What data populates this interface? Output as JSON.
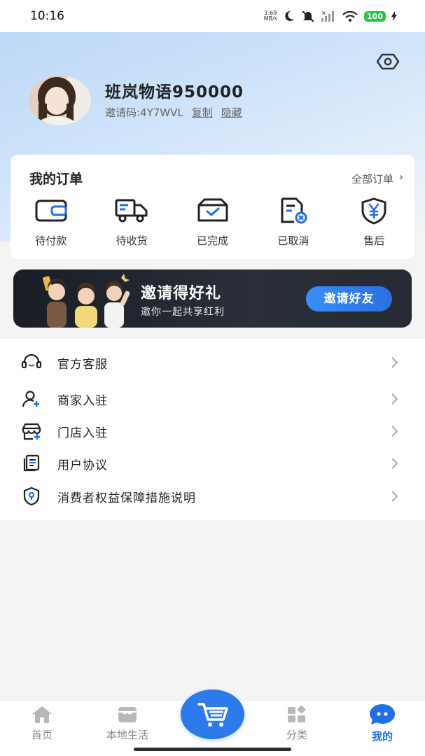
{
  "status_bar": {
    "time": "10:16",
    "net_speed_value": "1.69",
    "net_speed_unit": "MB/s",
    "battery": "100"
  },
  "profile": {
    "username": "班岚物语950000",
    "invite_code": "邀请码:4Y7WVL",
    "copy_label": "复制",
    "hide_label": "隐藏"
  },
  "orders": {
    "title": "我的订单",
    "all_label": "全部订单",
    "items": [
      {
        "label": "待付款",
        "icon": "wallet-icon"
      },
      {
        "label": "待收货",
        "icon": "truck-icon"
      },
      {
        "label": "已完成",
        "icon": "box-check-icon"
      },
      {
        "label": "已取消",
        "icon": "doc-cancel-icon"
      },
      {
        "label": "售后",
        "icon": "yen-shield-icon"
      }
    ]
  },
  "banner": {
    "title": "邀请得好礼",
    "subtitle": "邀你一起共享红利",
    "button": "邀请好友"
  },
  "menu": {
    "items": [
      {
        "label": "官方客服",
        "icon": "headset-icon"
      },
      {
        "label": "商家入驻",
        "icon": "user-plus-icon"
      },
      {
        "label": "门店入驻",
        "icon": "store-plus-icon"
      },
      {
        "label": "用户协议",
        "icon": "document-icon"
      },
      {
        "label": "消费者权益保障措施说明",
        "icon": "shield-icon"
      }
    ]
  },
  "tabbar": {
    "tabs": [
      {
        "label": "首页",
        "icon": "home-icon",
        "active": false
      },
      {
        "label": "本地生活",
        "icon": "shop-icon",
        "active": false
      },
      {
        "label": "",
        "icon": "cart-icon",
        "active": false
      },
      {
        "label": "分类",
        "icon": "category-icon",
        "active": false
      },
      {
        "label": "我的",
        "icon": "chat-bubble-icon",
        "active": true
      }
    ]
  },
  "colors": {
    "accent": "#1e6fe8",
    "cart_button": "#2d7bea",
    "battery": "#2bc24a",
    "banner_bg": "#1a1d26"
  }
}
